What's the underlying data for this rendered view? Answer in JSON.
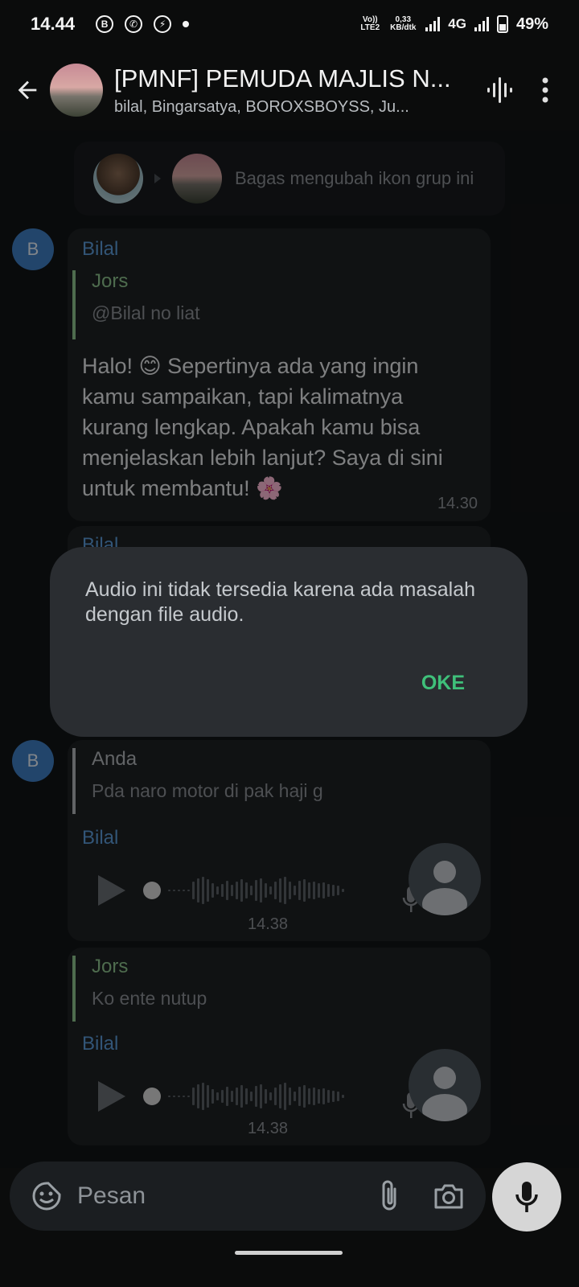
{
  "status_bar": {
    "time": "14.44",
    "network_rate": "0,33",
    "network_rate_unit": "KB/dtk",
    "volte": "Vo)) LTE2",
    "network_type": "4G",
    "battery": "49%",
    "notification_icons": [
      "b-circle-icon",
      "whatsapp-icon",
      "messenger-icon",
      "dot-icon"
    ]
  },
  "header": {
    "title": "[PMNF] PEMUDA MAJLIS N...",
    "subtitle": "bilal, Bingarsatya, BOROXSBOYSS, Ju...",
    "icons": [
      "back-arrow-icon",
      "voice-chat-icon",
      "more-vert-icon"
    ]
  },
  "service_message": {
    "text": "Bagas mengubah ikon grup ini"
  },
  "messages": [
    {
      "avatar_letter": "B",
      "sender": "Bilal",
      "reply_to": {
        "name": "Jors",
        "text": "@Bilal no liat"
      },
      "text_lines": [
        "Halo! 😊 Sepertinya ada yang ingin",
        "kamu sampaikan, tapi kalimatnya",
        "kurang lengkap. Apakah kamu bisa",
        "menjelaskan lebih lanjut? Saya di sini",
        "untuk membantu! 🌸"
      ],
      "time": "14.30"
    },
    {
      "sender": "Bilal"
    },
    {
      "avatar_letter": "B",
      "reply_to": {
        "name": "Anda",
        "text": "Pda naro motor di pak haji g"
      },
      "sender": "Bilal",
      "type": "voice",
      "time": "14.38"
    },
    {
      "reply_to": {
        "name": "Jors",
        "text": "Ko ente nutup"
      },
      "sender": "Bilal",
      "type": "voice",
      "time": "14.38"
    }
  ],
  "dialog": {
    "text": "Audio ini tidak tersedia karena ada masalah dengan file audio.",
    "button": "OKE"
  },
  "composer": {
    "placeholder": "Pesan",
    "icons": [
      "sticker-icon",
      "attach-icon",
      "camera-icon",
      "mic-icon"
    ]
  },
  "colors": {
    "sender_blue": "#5b9bd9",
    "jors_green": "#8fc58e",
    "anda_gray": "#b3b7bb",
    "ok_green": "#3fc07a",
    "avatar_blue": "#3f7ec4"
  }
}
